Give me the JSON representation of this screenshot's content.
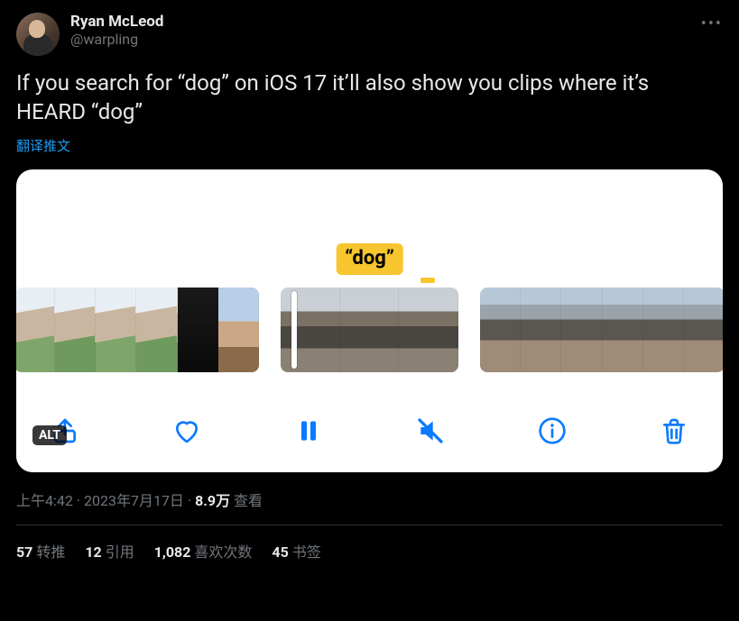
{
  "author": {
    "display_name": "Ryan McLeod",
    "handle": "@warpling"
  },
  "text": "If you search for “dog” on iOS 17 it’ll also show you clips where it’s HEARD “dog”",
  "translate_label": "翻译推文",
  "media": {
    "badge_text": "“dog”",
    "alt_label": "ALT",
    "toolbar_icons": {
      "share": "share-icon",
      "like": "heart-icon",
      "pause": "pause-icon",
      "mute": "speaker-muted-icon",
      "info": "info-icon",
      "trash": "trash-icon"
    }
  },
  "meta": {
    "time": "上午4:42",
    "date": "2023年7月17日",
    "views_number": "8.9万",
    "views_label": "查看",
    "sep": " · "
  },
  "stats": {
    "retweets": {
      "count": "57",
      "label": "转推"
    },
    "quotes": {
      "count": "12",
      "label": "引用"
    },
    "likes": {
      "count": "1,082",
      "label": "喜欢次数"
    },
    "bookmarks": {
      "count": "45",
      "label": "书签"
    }
  }
}
